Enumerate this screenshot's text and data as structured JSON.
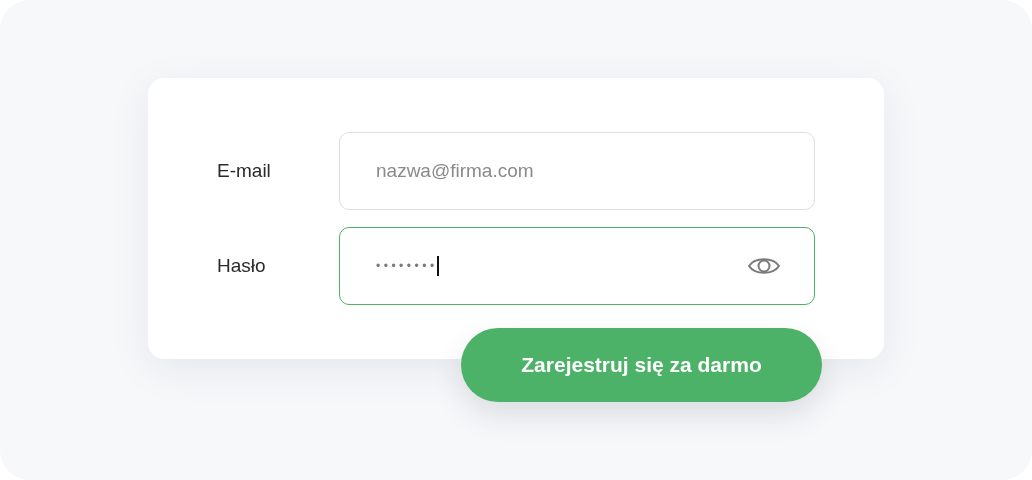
{
  "form": {
    "fields": [
      {
        "kind": "text",
        "label": "E-mail",
        "placeholder": "nazwa@firma.com",
        "focused": false
      },
      {
        "kind": "password",
        "label": "Hasło",
        "value": "••••••••",
        "focused": true
      }
    ],
    "submit": {
      "label": "Zarejestruj się za darmo"
    }
  }
}
